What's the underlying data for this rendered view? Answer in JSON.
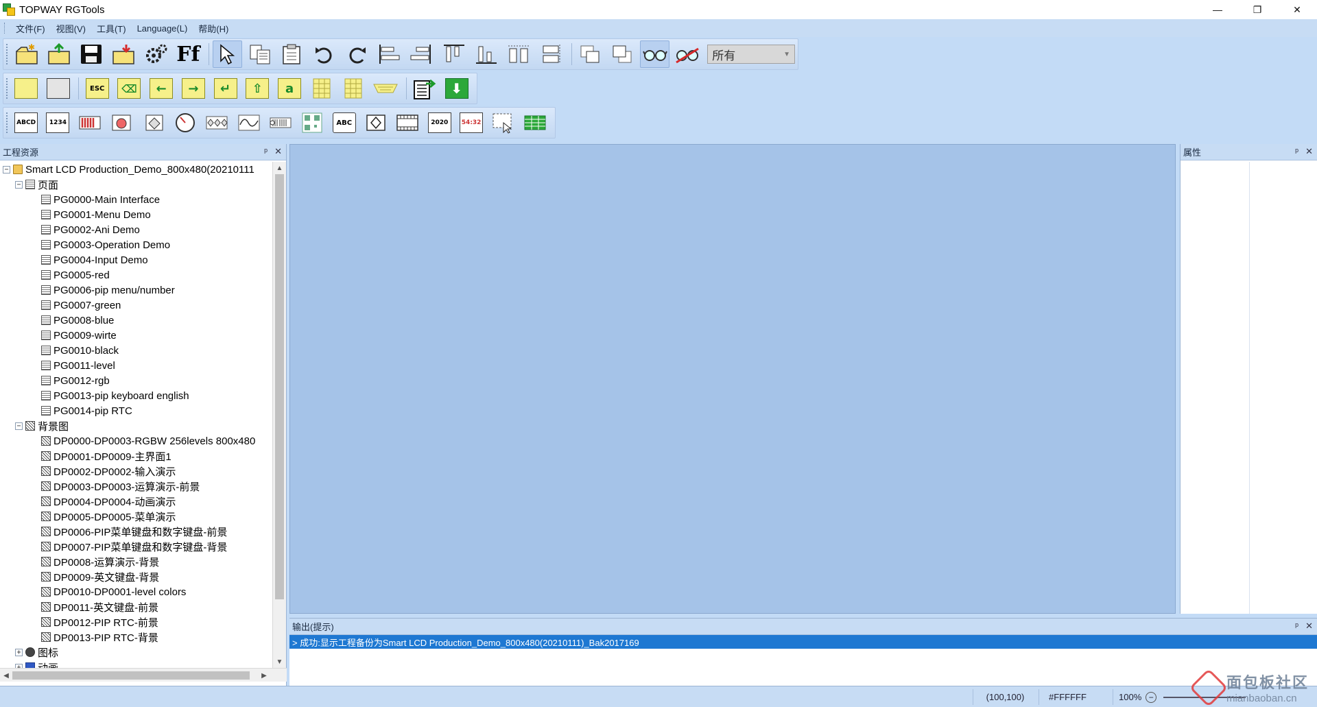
{
  "app": {
    "title": "TOPWAY RGTools"
  },
  "window_controls": {
    "minimize": "—",
    "restore": "❐",
    "close": "✕"
  },
  "menu": [
    {
      "label": "文件(F)"
    },
    {
      "label": "视图(V)"
    },
    {
      "label": "工具(T)"
    },
    {
      "label": "Language(L)"
    },
    {
      "label": "帮助(H)"
    }
  ],
  "toolbar1": {
    "buttons": [
      {
        "icon": "new-project-icon"
      },
      {
        "icon": "open-project-icon"
      },
      {
        "icon": "save-icon"
      },
      {
        "icon": "export-icon"
      },
      {
        "icon": "settings-icon"
      },
      {
        "icon": "font-icon",
        "text": "Ff"
      },
      {
        "icon": "pointer-icon"
      },
      {
        "icon": "copy-icon"
      },
      {
        "icon": "paste-icon"
      },
      {
        "icon": "undo-icon"
      },
      {
        "icon": "redo-icon"
      },
      {
        "icon": "align-left-icon"
      },
      {
        "icon": "align-right-icon"
      },
      {
        "icon": "align-top-icon"
      },
      {
        "icon": "align-bottom-icon"
      },
      {
        "icon": "same-width-icon"
      },
      {
        "icon": "same-height-icon"
      },
      {
        "icon": "bring-front-icon"
      },
      {
        "icon": "send-back-icon"
      },
      {
        "icon": "preview-icon"
      },
      {
        "icon": "preview-off-icon"
      }
    ],
    "combo": {
      "value": "所有"
    }
  },
  "toolbar2": {
    "buttons": [
      {
        "icon": "rect-area-icon"
      },
      {
        "icon": "frame-area-icon"
      },
      {
        "icon": "esc-key-icon",
        "text": "ESC"
      },
      {
        "icon": "backspace-key-icon",
        "text": "⌫"
      },
      {
        "icon": "arrow-left-key-icon",
        "text": "←"
      },
      {
        "icon": "arrow-right-key-icon",
        "text": "→"
      },
      {
        "icon": "enter-key-icon",
        "text": "↵"
      },
      {
        "icon": "shift-key-icon",
        "text": "⇧"
      },
      {
        "icon": "char-key-icon",
        "text": "a"
      },
      {
        "icon": "keypad-icon"
      },
      {
        "icon": "keypad-2-icon"
      },
      {
        "icon": "keyboard-icon"
      },
      {
        "icon": "build-icon"
      },
      {
        "icon": "download-icon",
        "text": "⬇"
      }
    ]
  },
  "toolbar3": {
    "buttons": [
      {
        "icon": "text-widget-icon",
        "text": "ABCD"
      },
      {
        "icon": "number-widget-icon",
        "text": "1234"
      },
      {
        "icon": "bar-widget-icon"
      },
      {
        "icon": "animation-widget-icon"
      },
      {
        "icon": "icon-widget-icon"
      },
      {
        "icon": "gauge-widget-icon"
      },
      {
        "icon": "multi-icon-widget-icon"
      },
      {
        "icon": "curve-widget-icon"
      },
      {
        "icon": "slider-widget-icon"
      },
      {
        "icon": "qr-widget-icon"
      },
      {
        "icon": "string-widget-icon",
        "text": "ABC"
      },
      {
        "icon": "icon-var-widget-icon"
      },
      {
        "icon": "video-widget-icon"
      },
      {
        "icon": "date-widget-icon",
        "text": "2020"
      },
      {
        "icon": "time-widget-icon",
        "text": "54:32"
      },
      {
        "icon": "touch-area-widget-icon"
      },
      {
        "icon": "table-widget-icon"
      }
    ]
  },
  "project_panel": {
    "title": "工程资源",
    "pin": "ᵖ",
    "close": "✕",
    "root": {
      "label": "Smart LCD Production_Demo_800x480(20210111"
    },
    "pages": {
      "label": "页面",
      "items": [
        "PG0000-Main Interface",
        "PG0001-Menu Demo",
        "PG0002-Ani Demo",
        "PG0003-Operation Demo",
        "PG0004-Input Demo",
        "PG0005-red",
        "PG0006-pip menu/number",
        "PG0007-green",
        "PG0008-blue",
        "PG0009-wirte",
        "PG0010-black",
        "PG0011-level",
        "PG0012-rgb",
        "PG0013-pip keyboard english",
        "PG0014-pip RTC"
      ]
    },
    "backgrounds": {
      "label": "背景图",
      "items": [
        "DP0000-DP0003-RGBW 256levels 800x480",
        "DP0001-DP0009-主界面1",
        "DP0002-DP0002-输入演示",
        "DP0003-DP0003-运算演示-前景",
        "DP0004-DP0004-动画演示",
        "DP0005-DP0005-菜单演示",
        "DP0006-PIP菜单键盘和数字键盘-前景",
        "DP0007-PIP菜单键盘和数字键盘-背景",
        "DP0008-运算演示-背景",
        "DP0009-英文键盘-背景",
        "DP0010-DP0001-level colors",
        "DP0011-英文键盘-前景",
        "DP0012-PIP RTC-前景",
        "DP0013-PIP RTC-背景"
      ]
    },
    "icons": {
      "label": "图标"
    },
    "animations": {
      "label": "动画"
    }
  },
  "properties_panel": {
    "title": "属性",
    "pin": "ᵖ",
    "close": "✕"
  },
  "output_panel": {
    "title": "输出(提示)",
    "pin": "ᵖ",
    "close": "✕",
    "lines": [
      "> 成功:显示工程备份为Smart LCD Production_Demo_800x480(20210111)_Bak2017169"
    ]
  },
  "status": {
    "coords": "(100,100)",
    "color": "#FFFFFF",
    "zoom": "100%"
  },
  "watermark": {
    "line1": "面包板社区",
    "line2": "mianbaoban.cn"
  },
  "colors": {
    "chrome": "#c7dcf4",
    "canvas": "#a5c3e8",
    "selection": "#1e78d2"
  }
}
